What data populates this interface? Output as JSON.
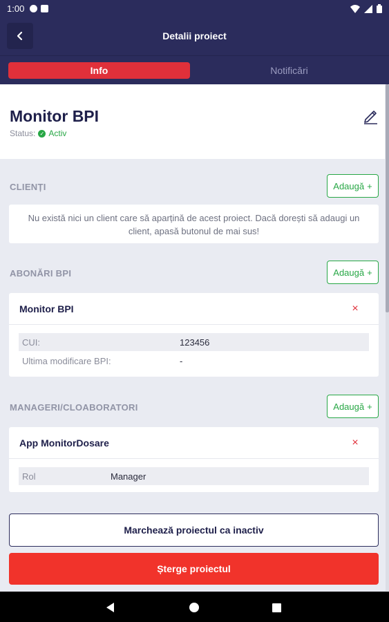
{
  "statusbar": {
    "time": "1:00"
  },
  "appbar": {
    "title": "Detalii proiect",
    "back_icon": "chevron-left-icon"
  },
  "tabs": [
    {
      "label": "Info",
      "active": true
    },
    {
      "label": "Notificări",
      "active": false
    }
  ],
  "project": {
    "name": "Monitor BPI",
    "status_label": "Status:",
    "status_value": "Activ",
    "status_color": "#27a745"
  },
  "clients": {
    "title": "CLIENȚI",
    "add_label": "Adaugă",
    "empty_text": "Nu există nici un client care să aparțină de acest proiect. Dacă dorești să adaugi un client, apasă butonul de mai sus!"
  },
  "subscriptions": {
    "title": "ABONĂRI BPI",
    "add_label": "Adaugă",
    "items": [
      {
        "name": "Monitor BPI",
        "rows": [
          {
            "key": "CUI:",
            "value": "123456"
          },
          {
            "key": "Ultima modificare BPI:",
            "value": "-"
          }
        ]
      }
    ]
  },
  "managers": {
    "title": "MANAGERI/CLOABORATORI",
    "add_label": "Adaugă",
    "items": [
      {
        "name": "App MonitorDosare",
        "rows": [
          {
            "key": "Rol",
            "value": "Manager"
          }
        ]
      }
    ]
  },
  "actions": {
    "mark_inactive": "Marchează proiectul ca inactiv",
    "delete": "Șterge proiectul"
  },
  "colors": {
    "primary": "#2b2c5c",
    "accent_red": "#e0303a",
    "danger": "#f1332b",
    "success": "#27a745"
  }
}
